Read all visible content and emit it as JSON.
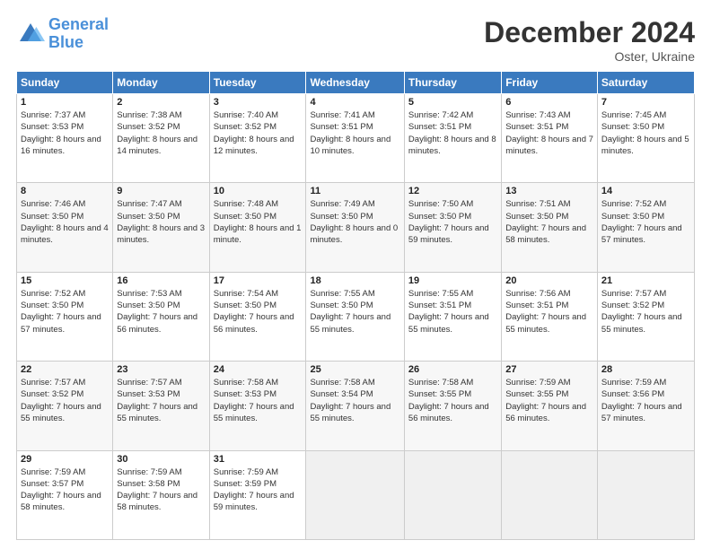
{
  "header": {
    "logo_general": "General",
    "logo_blue": "Blue",
    "month_title": "December 2024",
    "subtitle": "Oster, Ukraine"
  },
  "weekdays": [
    "Sunday",
    "Monday",
    "Tuesday",
    "Wednesday",
    "Thursday",
    "Friday",
    "Saturday"
  ],
  "weeks": [
    [
      {
        "day": "1",
        "sunrise": "7:37 AM",
        "sunset": "3:53 PM",
        "daylight": "8 hours and 16 minutes."
      },
      {
        "day": "2",
        "sunrise": "7:38 AM",
        "sunset": "3:52 PM",
        "daylight": "8 hours and 14 minutes."
      },
      {
        "day": "3",
        "sunrise": "7:40 AM",
        "sunset": "3:52 PM",
        "daylight": "8 hours and 12 minutes."
      },
      {
        "day": "4",
        "sunrise": "7:41 AM",
        "sunset": "3:51 PM",
        "daylight": "8 hours and 10 minutes."
      },
      {
        "day": "5",
        "sunrise": "7:42 AM",
        "sunset": "3:51 PM",
        "daylight": "8 hours and 8 minutes."
      },
      {
        "day": "6",
        "sunrise": "7:43 AM",
        "sunset": "3:51 PM",
        "daylight": "8 hours and 7 minutes."
      },
      {
        "day": "7",
        "sunrise": "7:45 AM",
        "sunset": "3:50 PM",
        "daylight": "8 hours and 5 minutes."
      }
    ],
    [
      {
        "day": "8",
        "sunrise": "7:46 AM",
        "sunset": "3:50 PM",
        "daylight": "8 hours and 4 minutes."
      },
      {
        "day": "9",
        "sunrise": "7:47 AM",
        "sunset": "3:50 PM",
        "daylight": "8 hours and 3 minutes."
      },
      {
        "day": "10",
        "sunrise": "7:48 AM",
        "sunset": "3:50 PM",
        "daylight": "8 hours and 1 minute."
      },
      {
        "day": "11",
        "sunrise": "7:49 AM",
        "sunset": "3:50 PM",
        "daylight": "8 hours and 0 minutes."
      },
      {
        "day": "12",
        "sunrise": "7:50 AM",
        "sunset": "3:50 PM",
        "daylight": "7 hours and 59 minutes."
      },
      {
        "day": "13",
        "sunrise": "7:51 AM",
        "sunset": "3:50 PM",
        "daylight": "7 hours and 58 minutes."
      },
      {
        "day": "14",
        "sunrise": "7:52 AM",
        "sunset": "3:50 PM",
        "daylight": "7 hours and 57 minutes."
      }
    ],
    [
      {
        "day": "15",
        "sunrise": "7:52 AM",
        "sunset": "3:50 PM",
        "daylight": "7 hours and 57 minutes."
      },
      {
        "day": "16",
        "sunrise": "7:53 AM",
        "sunset": "3:50 PM",
        "daylight": "7 hours and 56 minutes."
      },
      {
        "day": "17",
        "sunrise": "7:54 AM",
        "sunset": "3:50 PM",
        "daylight": "7 hours and 56 minutes."
      },
      {
        "day": "18",
        "sunrise": "7:55 AM",
        "sunset": "3:50 PM",
        "daylight": "7 hours and 55 minutes."
      },
      {
        "day": "19",
        "sunrise": "7:55 AM",
        "sunset": "3:51 PM",
        "daylight": "7 hours and 55 minutes."
      },
      {
        "day": "20",
        "sunrise": "7:56 AM",
        "sunset": "3:51 PM",
        "daylight": "7 hours and 55 minutes."
      },
      {
        "day": "21",
        "sunrise": "7:57 AM",
        "sunset": "3:52 PM",
        "daylight": "7 hours and 55 minutes."
      }
    ],
    [
      {
        "day": "22",
        "sunrise": "7:57 AM",
        "sunset": "3:52 PM",
        "daylight": "7 hours and 55 minutes."
      },
      {
        "day": "23",
        "sunrise": "7:57 AM",
        "sunset": "3:53 PM",
        "daylight": "7 hours and 55 minutes."
      },
      {
        "day": "24",
        "sunrise": "7:58 AM",
        "sunset": "3:53 PM",
        "daylight": "7 hours and 55 minutes."
      },
      {
        "day": "25",
        "sunrise": "7:58 AM",
        "sunset": "3:54 PM",
        "daylight": "7 hours and 55 minutes."
      },
      {
        "day": "26",
        "sunrise": "7:58 AM",
        "sunset": "3:55 PM",
        "daylight": "7 hours and 56 minutes."
      },
      {
        "day": "27",
        "sunrise": "7:59 AM",
        "sunset": "3:55 PM",
        "daylight": "7 hours and 56 minutes."
      },
      {
        "day": "28",
        "sunrise": "7:59 AM",
        "sunset": "3:56 PM",
        "daylight": "7 hours and 57 minutes."
      }
    ],
    [
      {
        "day": "29",
        "sunrise": "7:59 AM",
        "sunset": "3:57 PM",
        "daylight": "7 hours and 58 minutes."
      },
      {
        "day": "30",
        "sunrise": "7:59 AM",
        "sunset": "3:58 PM",
        "daylight": "7 hours and 58 minutes."
      },
      {
        "day": "31",
        "sunrise": "7:59 AM",
        "sunset": "3:59 PM",
        "daylight": "7 hours and 59 minutes."
      },
      null,
      null,
      null,
      null
    ]
  ]
}
